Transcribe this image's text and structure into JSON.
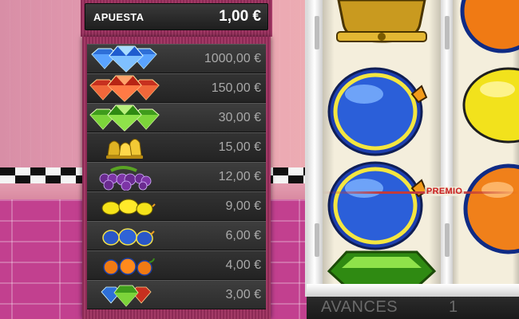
{
  "bet": {
    "label": "APUESTA",
    "value": "1,00 €"
  },
  "paytable": [
    {
      "symbol": "blue-diamonds-icon",
      "prize": "1000,00 €"
    },
    {
      "symbol": "red-diamonds-icon",
      "prize": "150,00 €"
    },
    {
      "symbol": "green-diamonds-icon",
      "prize": "30,00 €"
    },
    {
      "symbol": "golden-bells-icon",
      "prize": "15,00 €"
    },
    {
      "symbol": "grapes-icon",
      "prize": "12,00 €"
    },
    {
      "symbol": "lemons-icon",
      "prize": "9,00 €"
    },
    {
      "symbol": "plums-icon",
      "prize": "6,00 €"
    },
    {
      "symbol": "oranges-icon",
      "prize": "4,00 €"
    },
    {
      "symbol": "mixed-diamonds-icon",
      "prize": "3,00 €"
    }
  ],
  "reels": {
    "reel1": [
      "bell",
      "plum",
      "plum",
      "green-diamond"
    ],
    "reel2": [
      "orange",
      "lemon",
      "orange"
    ]
  },
  "payline_label": "PREMIO",
  "advances": {
    "label": "AVANCES",
    "value": "1"
  },
  "colors": {
    "frame": "#9a3461",
    "row": "#2f2f2f",
    "prize_text": "#a9a9a9",
    "payline": "#c23b3b"
  }
}
